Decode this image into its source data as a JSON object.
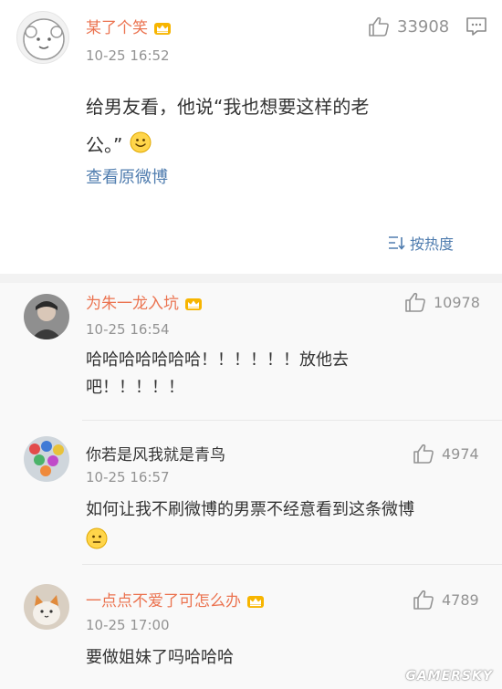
{
  "main_post": {
    "username": "某了个笑",
    "timestamp": "10-25 16:52",
    "like_count": "33908",
    "text_line1": "给男友看，他说“我也想要这样的老",
    "text_line2": "公。”",
    "view_original": "查看原微博",
    "sort_label": "按热度"
  },
  "comments": [
    {
      "username": "为朱一龙入坑",
      "timestamp": "10-25 16:54",
      "like_count": "10978",
      "text_line1": "哈哈哈哈哈哈哈！！！！！！放他去",
      "text_line2": "吧！！！！！"
    },
    {
      "username": "你若是风我就是青鸟",
      "timestamp": "10-25 16:57",
      "like_count": "4974",
      "text_line1": "如何让我不刷微博的男票不经意看到这条微博"
    },
    {
      "username": "一点点不爱了可怎么办",
      "timestamp": "10-25 17:00",
      "like_count": "4789",
      "text_line1": "要做姐妹了吗哈哈哈"
    }
  ],
  "watermark": "GAMERSKY",
  "colors": {
    "username_vip": "#eb7350",
    "link": "#507daf",
    "timestamp": "#939393",
    "comment_bg": "#f9f9f9"
  },
  "icons": [
    "crown-icon",
    "thumbs-up-icon",
    "comment-icon",
    "smile-emoji-icon",
    "sort-icon"
  ]
}
